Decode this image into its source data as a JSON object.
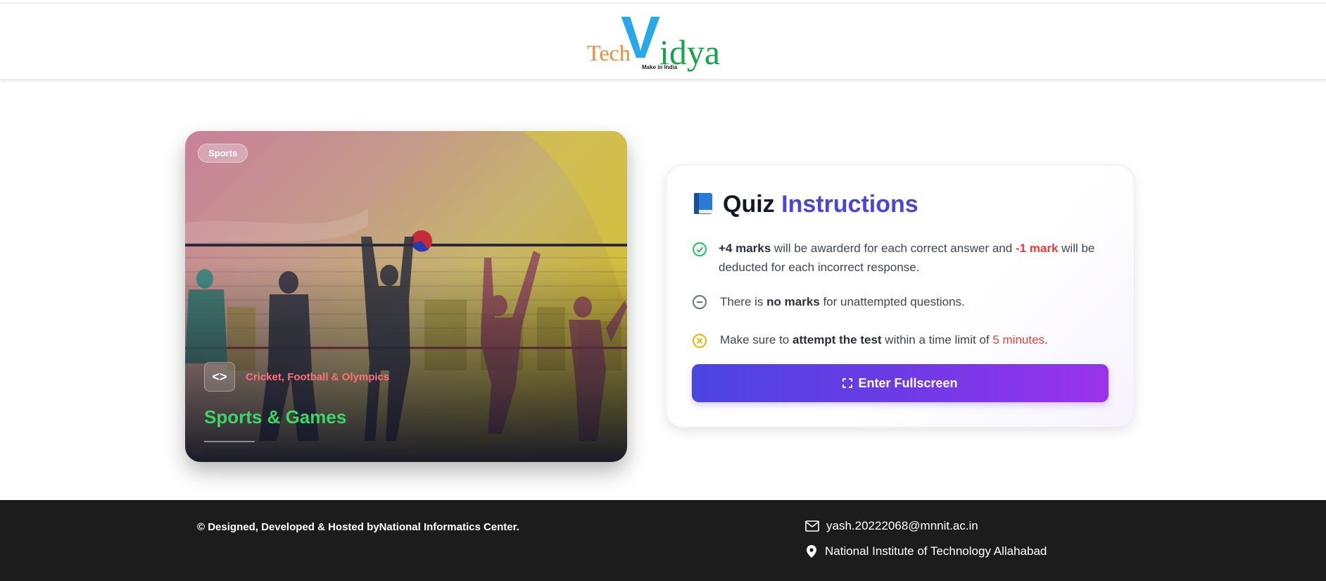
{
  "header": {
    "logo": {
      "tech": "Tech",
      "v": "V",
      "idya": "idya",
      "tagline": "Make in India"
    }
  },
  "card": {
    "badge": "Sports",
    "code_icon": "code-icon",
    "subcategory": "Cricket, Football & Olympics",
    "title": "Sports & Games"
  },
  "instructions": {
    "title_main": "Quiz",
    "title_accent": "Instructions",
    "title_icon": "book-icon",
    "rows": [
      {
        "icon": "check-circle-icon",
        "parts": [
          "+4 marks",
          " will be awarderd for each correct answer and ",
          "-1 mark",
          " will be deducted for each incorrect response."
        ]
      },
      {
        "icon": "minus-circle-icon",
        "parts": [
          "There is ",
          "no marks",
          " for unattempted questions."
        ]
      },
      {
        "icon": "x-circle-icon",
        "parts": [
          "Make sure to ",
          "attempt the test",
          " within a time limit of ",
          "5 minutes",
          "."
        ]
      }
    ],
    "button_label": "Enter Fullscreen",
    "button_icon": "fullscreen-icon"
  },
  "footer": {
    "copyright": "© Designed, Developed & Hosted byNational Informatics Center.",
    "email": "yash.20222068@mnnit.ac.in",
    "address": "National Institute of Technology Allahabad"
  },
  "colors": {
    "accent": "#4b45d8",
    "green": "#22c55e",
    "red": "#ef3b3b",
    "yellow": "#e9b308",
    "footer_bg": "#1c1c1c"
  }
}
